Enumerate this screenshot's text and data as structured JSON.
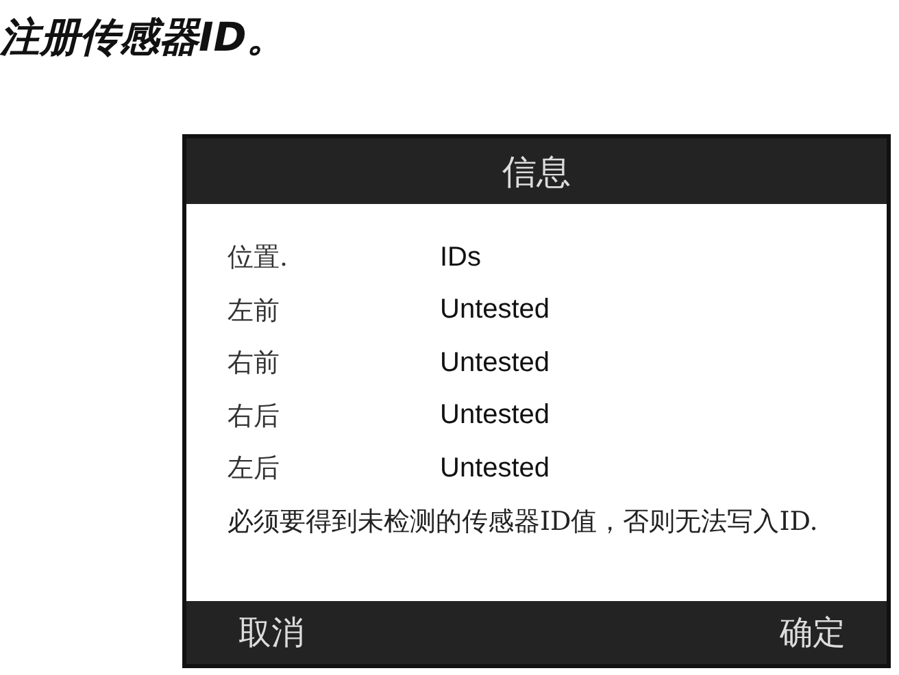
{
  "heading": "注册传感器ID。",
  "screen": {
    "title": "信息",
    "columns": [
      "位置.",
      "IDs"
    ],
    "rows": [
      {
        "position": "左前",
        "id": "Untested"
      },
      {
        "position": "右前",
        "id": "Untested"
      },
      {
        "position": "右后",
        "id": "Untested"
      },
      {
        "position": "左后",
        "id": "Untested"
      }
    ],
    "message": "必须要得到未检测的传感器ID值，否则无法写入ID.",
    "buttons": [
      "取消",
      "确定"
    ]
  }
}
